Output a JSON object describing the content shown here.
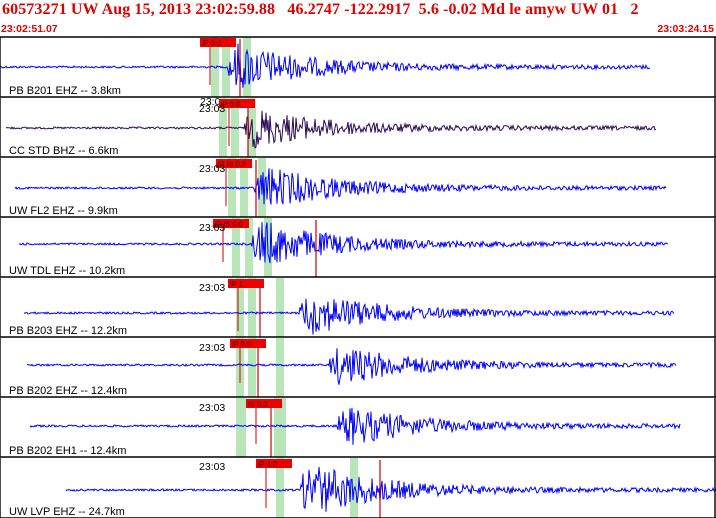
{
  "header": {
    "title": "60573271 UW Aug 15, 2013 23:02:59.88   46.2747 -122.2917  5.6 -0.02 Md le amyw UW 01   2",
    "start_time": "23:02:51.07",
    "end_time": "23:03:24.15"
  },
  "colors": {
    "header_text": "#e00000",
    "trace": "#0000ff",
    "trace_alt": "#2a0a55",
    "pick_box": "#ee0000",
    "pick_line": "#cc0000",
    "window_band": "#b8e6b8",
    "frame": "#000000"
  },
  "panels": [
    {
      "label": "PB B201 EHZ -- 3.8km",
      "time_label": "23:03",
      "pick": "iP 0.0",
      "color": "#0000ff"
    },
    {
      "label": "CC STD BHZ -- 6.6km",
      "time_label": "23:03",
      "pick": "iP 0.0",
      "color": "#2a0a55"
    },
    {
      "label": "UW FL2 EHZ -- 9.9km",
      "time_label": "23:03",
      "pick": "iP iS 0.0",
      "color": "#0000ff"
    },
    {
      "label": "UW TDL EHZ -- 10.2km",
      "time_label": "23:03",
      "pick": "iP iS 0.0",
      "color": "#0000ff"
    },
    {
      "label": "PB B203 EHZ -- 12.2km",
      "time_label": "23:03",
      "pick": "iP 1",
      "color": "#0000ff"
    },
    {
      "label": "PB B202 EHZ -- 12.4km",
      "time_label": "23:03",
      "pick": "iP 0.0",
      "color": "#0000ff"
    },
    {
      "label": "PB B202 EH1 -- 12.4km",
      "time_label": "23:03",
      "pick": "iS 0.0",
      "color": "#0000ff"
    },
    {
      "label": "UW LVP EHZ -- 24.7km",
      "time_label": "23:03",
      "pick": "iP 4.0",
      "color": "#0000ff"
    }
  ]
}
